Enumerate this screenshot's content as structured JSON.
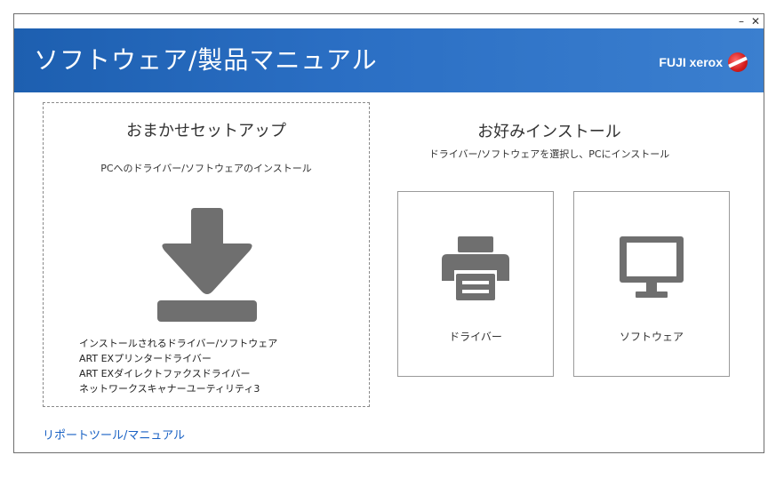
{
  "window": {
    "minimize_label": "–",
    "close_label": "✕"
  },
  "header": {
    "title": "ソフトウェア/製品マニュアル",
    "brand_name": "FUJI xerox"
  },
  "quick_setup": {
    "title": "おまかせセットアップ",
    "description": "PCへのドライバー/ソフトウェアのインストール",
    "icon": "download-icon",
    "items": [
      "インストールされるドライバー/ソフトウェア",
      "ART EXプリンタードライバー",
      "ART EXダイレクトファクスドライバー",
      "ネットワークスキャナーユーティリティ3"
    ]
  },
  "custom_install": {
    "title": "お好みインストール",
    "description": "ドライバー/ソフトウェアを選択し、PCにインストール",
    "cards": [
      {
        "label": "ドライバー",
        "icon": "printer-icon"
      },
      {
        "label": "ソフトウェア",
        "icon": "monitor-icon"
      }
    ]
  },
  "footer": {
    "link_label": "リポートツール/マニュアル"
  },
  "colors": {
    "header_start": "#1d5fb0",
    "header_end": "#3b7fcf",
    "icon_gray": "#6f6f6f",
    "link_blue": "#1a62c4"
  }
}
